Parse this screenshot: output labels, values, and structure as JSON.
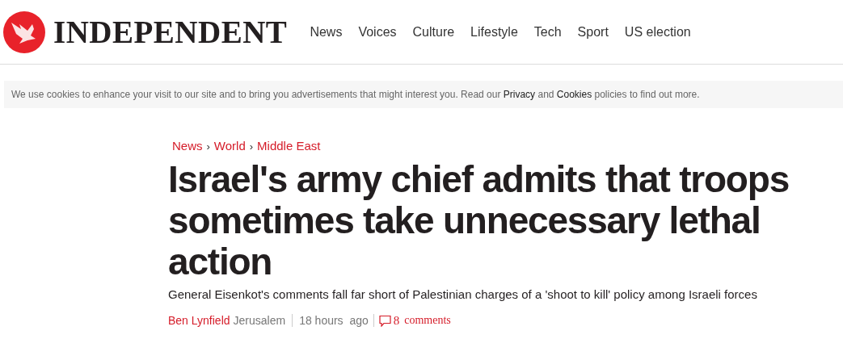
{
  "header": {
    "logo_text": "INDEPENDENT",
    "nav": [
      {
        "label": "News"
      },
      {
        "label": "Voices"
      },
      {
        "label": "Culture"
      },
      {
        "label": "Lifestyle"
      },
      {
        "label": "Tech"
      },
      {
        "label": "Sport"
      },
      {
        "label": "US election"
      }
    ]
  },
  "cookie_notice": {
    "before": "We use cookies to enhance your visit to our site and to bring you advertisements that might interest you. Read our",
    "link_1": "Privacy",
    "between": "and",
    "link_2": "Cookies",
    "after": "policies to find out more."
  },
  "article": {
    "breadcrumb": [
      {
        "label": "News"
      },
      {
        "label": "World",
        "separator": "›"
      },
      {
        "label": "Middle East",
        "separator": "›"
      }
    ],
    "headline": "Israel's army chief admits that troops sometimes take unnecessary lethal action",
    "standfirst": "General Eisenkot's comments fall far short of Palestinian charges of a 'shoot to kill' policy among Israeli forces",
    "byline": {
      "author": "Ben Lynfield",
      "location": "Jerusalem",
      "time": "18 hours  ago",
      "comment_count": "8",
      "comment_label": "comments"
    }
  }
}
